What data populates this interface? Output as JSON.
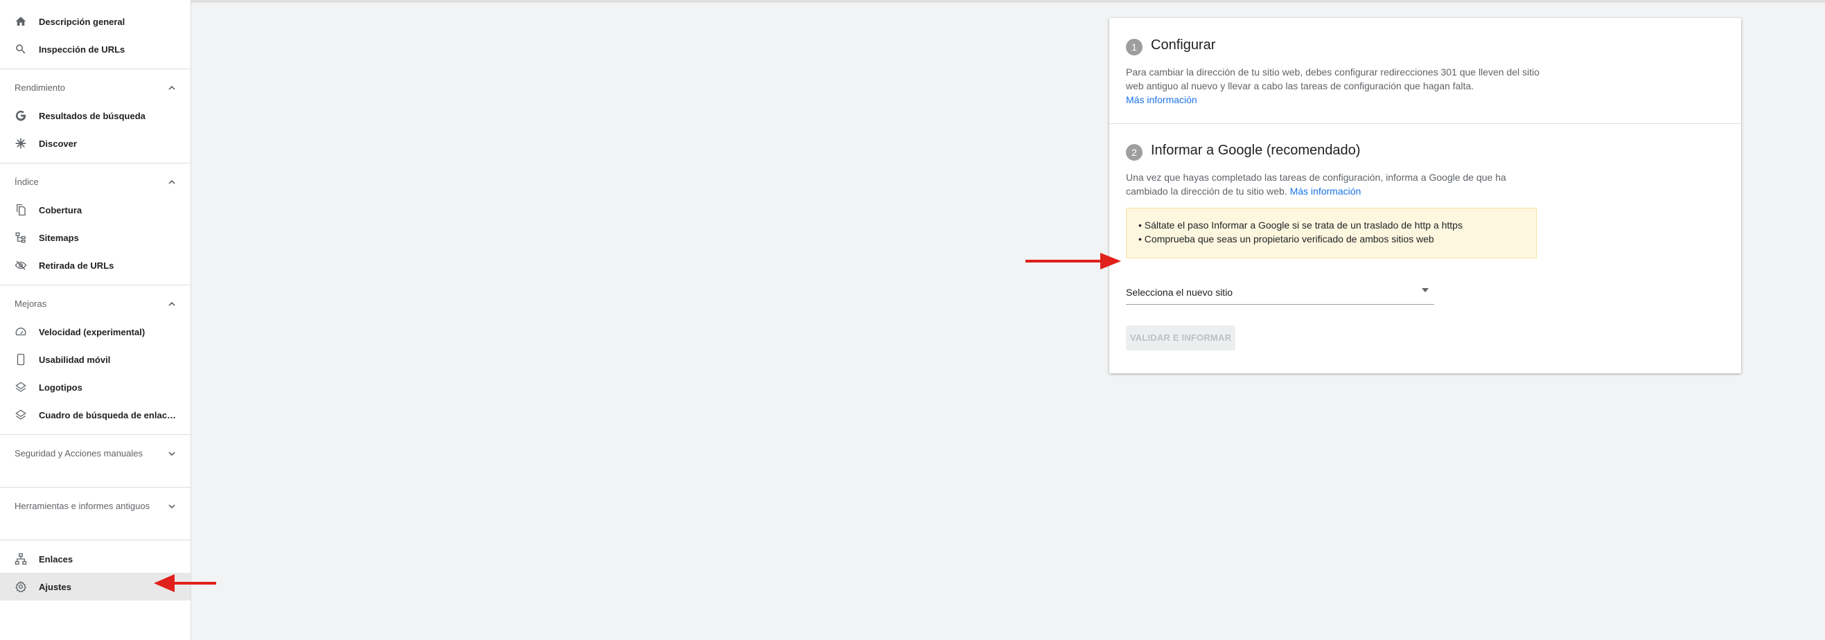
{
  "sidebar": {
    "top_items": [
      {
        "label": "Descripción general",
        "icon": "home-icon"
      },
      {
        "label": "Inspección de URLs",
        "icon": "search-icon"
      }
    ],
    "sections": [
      {
        "title": "Rendimiento",
        "expanded": true,
        "items": [
          {
            "label": "Resultados de búsqueda",
            "icon": "google-g-icon"
          },
          {
            "label": "Discover",
            "icon": "asterisk-icon"
          }
        ]
      },
      {
        "title": "Índice",
        "expanded": true,
        "items": [
          {
            "label": "Cobertura",
            "icon": "file-copy-icon"
          },
          {
            "label": "Sitemaps",
            "icon": "sitemap-icon"
          },
          {
            "label": "Retirada de URLs",
            "icon": "eye-off-icon"
          }
        ]
      },
      {
        "title": "Mejoras",
        "expanded": true,
        "items": [
          {
            "label": "Velocidad (experimental)",
            "icon": "speedometer-icon"
          },
          {
            "label": "Usabilidad móvil",
            "icon": "smartphone-icon"
          },
          {
            "label": "Logotipos",
            "icon": "layers-icon"
          },
          {
            "label": "Cuadro de búsqueda de enlaces de sitio",
            "icon": "layers-icon"
          }
        ]
      },
      {
        "title": "Seguridad y Acciones manuales",
        "expanded": false,
        "items": []
      },
      {
        "title": "Herramientas e informes antiguos",
        "expanded": false,
        "items": []
      }
    ],
    "bottom_items": [
      {
        "label": "Enlaces",
        "icon": "sitemap-icon"
      },
      {
        "label": "Ajustes",
        "icon": "gear-icon",
        "active": true
      }
    ]
  },
  "card": {
    "step1": {
      "number": "1",
      "title": "Configurar",
      "text": "Para cambiar la dirección de tu sitio web, debes configurar redirecciones 301 que lleven del sitio web antiguo al nuevo y llevar a cabo las tareas de configuración que hagan falta.",
      "link": "Más información"
    },
    "step2": {
      "number": "2",
      "title": "Informar a Google (recomendado)",
      "text": "Una vez que hayas completado las tareas de configuración, informa a Google de que ha cambiado la dirección de tu sitio web.",
      "link": "Más información"
    },
    "warning": [
      "• Sáltate el paso Informar a Google si se trata de un traslado de http a https",
      "• Comprueba que seas un propietario verificado de ambos sitios web"
    ],
    "select_placeholder": "Selecciona el nuevo sitio",
    "submit_button": "Validar e informar"
  },
  "colors": {
    "link": "#1a73e8",
    "warning_bg": "#fef7e0",
    "annotation_arrow": "#e0201b",
    "active_item_bg": "#e8e8e8"
  }
}
